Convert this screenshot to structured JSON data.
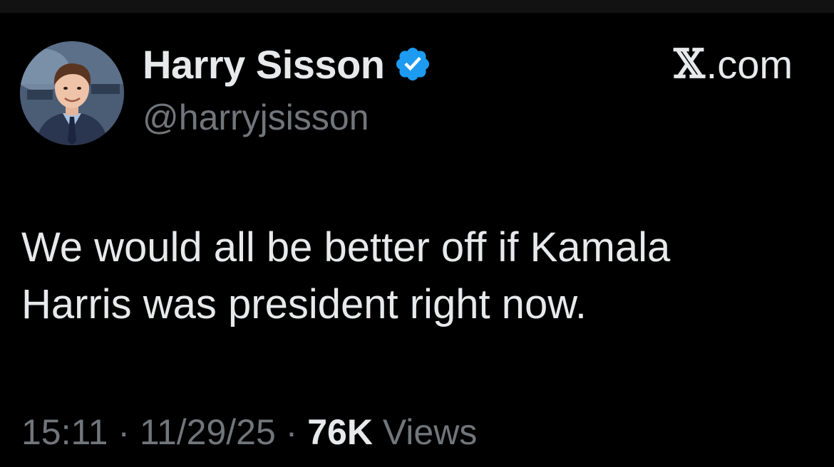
{
  "author": {
    "display_name": "Harry Sisson",
    "handle": "@harryjsisson",
    "verified": true,
    "verified_color": "#1d9bf0",
    "avatar_icon": "profile-photo"
  },
  "source": {
    "logo_letter": "𝕏",
    "label": ".com"
  },
  "tweet": {
    "line1": "We would all be better off if Kamala",
    "line2": "Harris was president right now."
  },
  "meta": {
    "time": "15:11",
    "separator1": " · ",
    "date": "11/29/25",
    "separator2": " · ",
    "views_count": "76K",
    "views_label": " Views"
  },
  "colors": {
    "background": "#000000",
    "primary_text": "#e7e9ea",
    "secondary_text": "#71767b"
  }
}
